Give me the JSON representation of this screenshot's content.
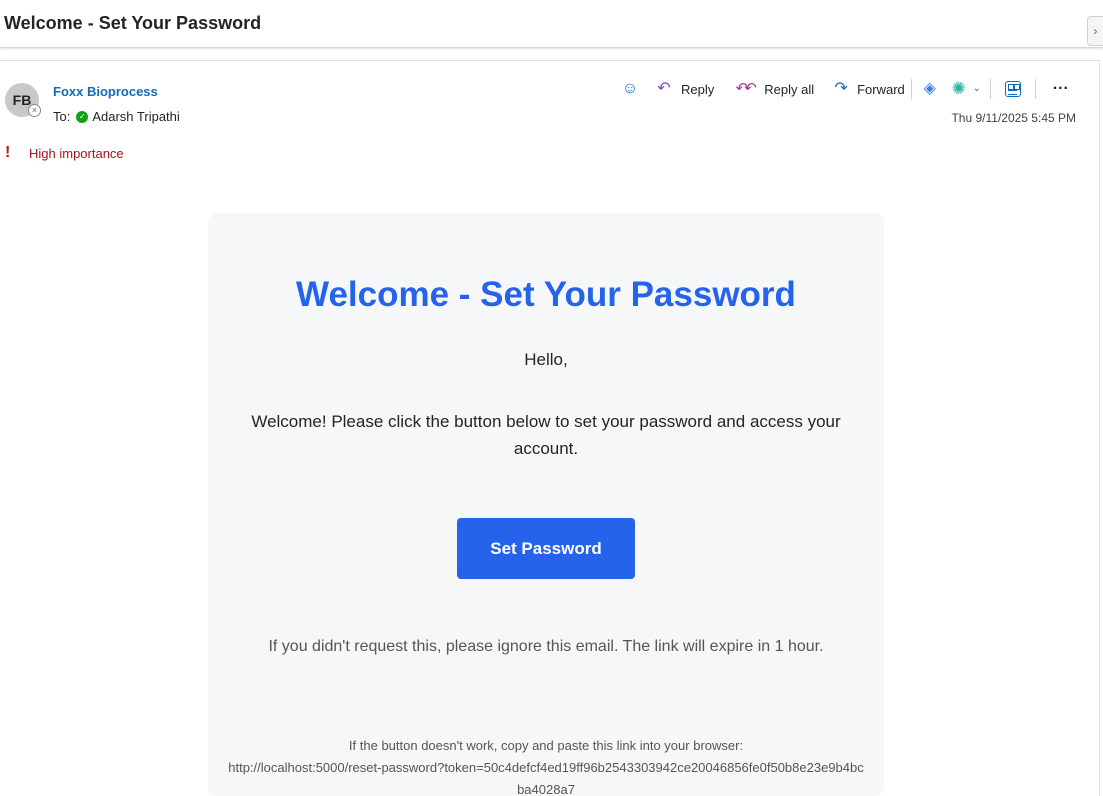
{
  "email": {
    "subject": "Welcome - Set Your Password",
    "sender_initials": "FB",
    "sender_name": "Foxx Bioprocess",
    "to_label": "To:",
    "recipient": "Adarsh Tripathi",
    "date": "Thu 9/11/2025 5:45 PM",
    "importance": "High importance"
  },
  "toolbar": {
    "reply": "Reply",
    "reply_all": "Reply all",
    "forward": "Forward",
    "icons": [
      "emoji-icon",
      "reply-icon",
      "reply-all-icon",
      "forward-icon",
      "loop-icon",
      "copilot-icon",
      "chevron-down-icon",
      "apps-icon",
      "more-icon"
    ]
  },
  "body": {
    "title": "Welcome - Set Your Password",
    "greeting": "Hello,",
    "message": "Welcome! Please click the button below to set your password and access your account.",
    "button": "Set Password",
    "ignore_note": "If you didn't request this, please ignore this email. The link will expire in 1 hour.",
    "fallback_intro": "If the button doesn't work, copy and paste this link into your browser:",
    "fallback_link": "http://localhost:5000/reset-password?token=50c4defcf4ed19ff96b2543303942ce20046856fe0f50b8e23e9b4bcba4028a7"
  },
  "colors": {
    "accent": "#2563eb",
    "sender_link": "#0f6cbd",
    "importance": "#b10e1c",
    "card_bg": "#f6f7f9"
  }
}
